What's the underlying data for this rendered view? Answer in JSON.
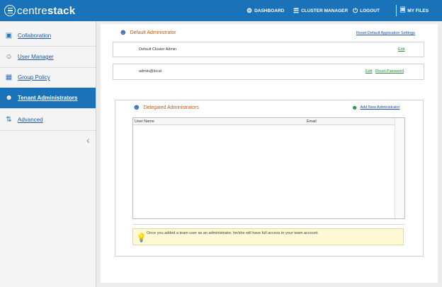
{
  "brand": {
    "prefix": "centre",
    "suffix": "stack"
  },
  "topnav": {
    "dashboard": "DASHBOARD",
    "cluster_manager": "CLUSTER MANAGER",
    "logout": "LOGOUT",
    "my_files": "MY FILES"
  },
  "sidebar": {
    "items": [
      {
        "label": "Collaboration",
        "icon": "collaboration-icon"
      },
      {
        "label": "User Manager",
        "icon": "users-icon"
      },
      {
        "label": "Group Policy",
        "icon": "policy-icon"
      },
      {
        "label": "Tenant Administrators",
        "icon": "admins-icon",
        "active": true
      },
      {
        "label": "Advanced",
        "icon": "advanced-icon"
      }
    ]
  },
  "default_admin": {
    "title": "Default Administrator",
    "reset_link": "Reset Default Application Settings",
    "rows": [
      {
        "name": "Default Cluster Admin",
        "edit": "Edit"
      },
      {
        "name": "admin@local",
        "edit": "Edit",
        "reset_password": "Reset Password"
      }
    ]
  },
  "delegated": {
    "title": "Delegated Administrators",
    "add_link": "Add New Administrator",
    "columns": [
      "User Name",
      "Email"
    ],
    "hint": "Once you added a team user as an administrator, he/she will have full access to your team account."
  },
  "colors": {
    "topbar": "#1a73b8",
    "accent_orange": "#c05a10",
    "link_blue": "#1c4fa0",
    "link_green": "#2a8a3a"
  }
}
